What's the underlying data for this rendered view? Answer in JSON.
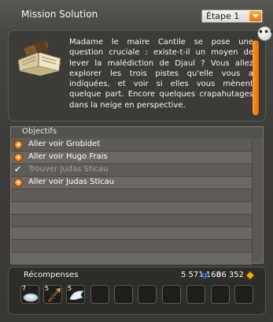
{
  "window": {
    "title": "Mission Solution"
  },
  "step_select": {
    "value": "Étape 1"
  },
  "description": {
    "text": "Madame le maire Cantile se pose une question cruciale : existe-t-il un moyen de lever la malédiction de Djaul ? Vous allez explorer les trois pistes qu'elle vous a indiquées, et voir si elles vous mènent quelque part. Encore quelques crapahutages dans la neige en perspective."
  },
  "more_button": {
    "label": "•••"
  },
  "objectives": {
    "header": "Objectifs",
    "items": [
      {
        "label": "Aller voir Grobidet",
        "done": false
      },
      {
        "label": "Aller voir Hugo Frais",
        "done": false
      },
      {
        "label": "Trouver Judas Sticau",
        "done": true
      },
      {
        "label": "Aller voir Judas Sticau",
        "done": false
      },
      {
        "label": "",
        "done": null
      },
      {
        "label": "",
        "done": null
      },
      {
        "label": "",
        "done": null
      },
      {
        "label": "",
        "done": null
      },
      {
        "label": "",
        "done": null
      },
      {
        "label": "",
        "done": null
      }
    ]
  },
  "rewards": {
    "title": "Récompenses",
    "xp": "5 571 168",
    "xp_icon": "xp-icon",
    "kamas": "86 352",
    "kamas_icon": "kama-icon",
    "items": [
      {
        "qty": "7",
        "icon": "plate-icon"
      },
      {
        "qty": "5",
        "icon": "weapon-icon"
      },
      {
        "qty": "5",
        "icon": "wing-icon"
      }
    ],
    "empty_slots": 8
  },
  "colors": {
    "accent_orange": "#f07c12",
    "panel": "#3d3b37",
    "xp_blue": "#3f8fe0"
  }
}
